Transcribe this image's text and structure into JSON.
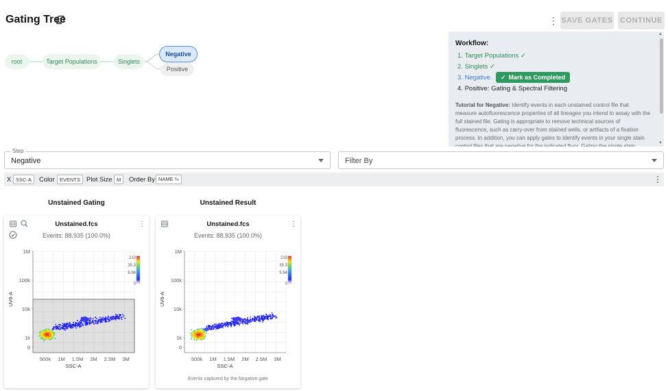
{
  "header": {
    "title": "Gating Tree",
    "save_gates": "SAVE GATES",
    "continue": "CONTINUE"
  },
  "tree": {
    "nodes": [
      {
        "label": "root",
        "state": "done"
      },
      {
        "label": "Target Populations",
        "state": "done"
      },
      {
        "label": "Singlets",
        "state": "done"
      },
      {
        "label": "Negative",
        "state": "active"
      },
      {
        "label": "Positive",
        "state": "pending"
      }
    ]
  },
  "workflow": {
    "title": "Workflow:",
    "steps": [
      {
        "num": "1.",
        "label": "Target Populations",
        "check": "✓"
      },
      {
        "num": "2.",
        "label": "Singlets",
        "check": "✓"
      },
      {
        "num": "3.",
        "label": "Negative",
        "check": ""
      },
      {
        "num": "4.",
        "label": "Positive: Gating & Spectral Filtering",
        "check": ""
      }
    ],
    "mark_completed": "Mark as Completed",
    "tutorial_heading": "Tutorial for Negative:",
    "tutorial_text": "Identify events in each unstained control file that measure autofluorescence properties of all lineages you intend to assay with the full stained file. Gating is appropriate to remove technical sources of fluorescence, such as carry-over from stained wells, or artifacts of a fixation process. In addition, you can apply gates to identify events in your single stain control files that are negative for the indicated fluor. Gating the single stain controls can be"
  },
  "filters": {
    "step_legend": "Step",
    "step_value": "Negative",
    "filter_placeholder": "Filter By"
  },
  "toolbar": {
    "x_label": "X",
    "x_value": "SSC-A",
    "color_label": "Color",
    "color_value": "EVENTS",
    "plot_size_label": "Plot Size",
    "plot_size_value": "M",
    "order_by_label": "Order By",
    "order_by_value": "NAME ⥱"
  },
  "plots": [
    {
      "section_title": "Unstained Gating",
      "file": "Unstained.fcs",
      "events": "Events: 88,935 (100.0%)",
      "caption": "",
      "has_gate": true
    },
    {
      "section_title": "Unstained Result",
      "file": "Unstained.fcs",
      "events": "Events: 88,935 (100.0%)",
      "caption": "Events captured by the Negative gate",
      "has_gate": false
    }
  ],
  "chart_data": [
    {
      "type": "scatter",
      "title": "Unstained.fcs",
      "xlabel": "SSC-A",
      "ylabel": "UV6-A",
      "x_ticks": [
        "500k",
        "1M",
        "1.5M",
        "2M",
        "2.5M",
        "3M"
      ],
      "y_ticks": [
        "0",
        "1k",
        "10k",
        "100k",
        "1M"
      ],
      "y_scale": "biexponential",
      "colorbar_ticks": [
        "210",
        "35.3",
        "5.94",
        "0"
      ],
      "grid": true
    },
    {
      "type": "scatter",
      "title": "Unstained.fcs",
      "xlabel": "SSC-A",
      "ylabel": "UV6-A",
      "x_ticks": [
        "500k",
        "1M",
        "1.5M",
        "2M",
        "2.5M",
        "3M"
      ],
      "y_ticks": [
        "0",
        "1k",
        "10k",
        "100k",
        "1M"
      ],
      "y_scale": "biexponential",
      "colorbar_ticks": [
        "210",
        "35.3",
        "5.94",
        "0"
      ],
      "grid": true
    }
  ],
  "colors": {
    "done": "#2e8b57",
    "active": "#3f7fd1",
    "panel": "#e9edf1"
  }
}
